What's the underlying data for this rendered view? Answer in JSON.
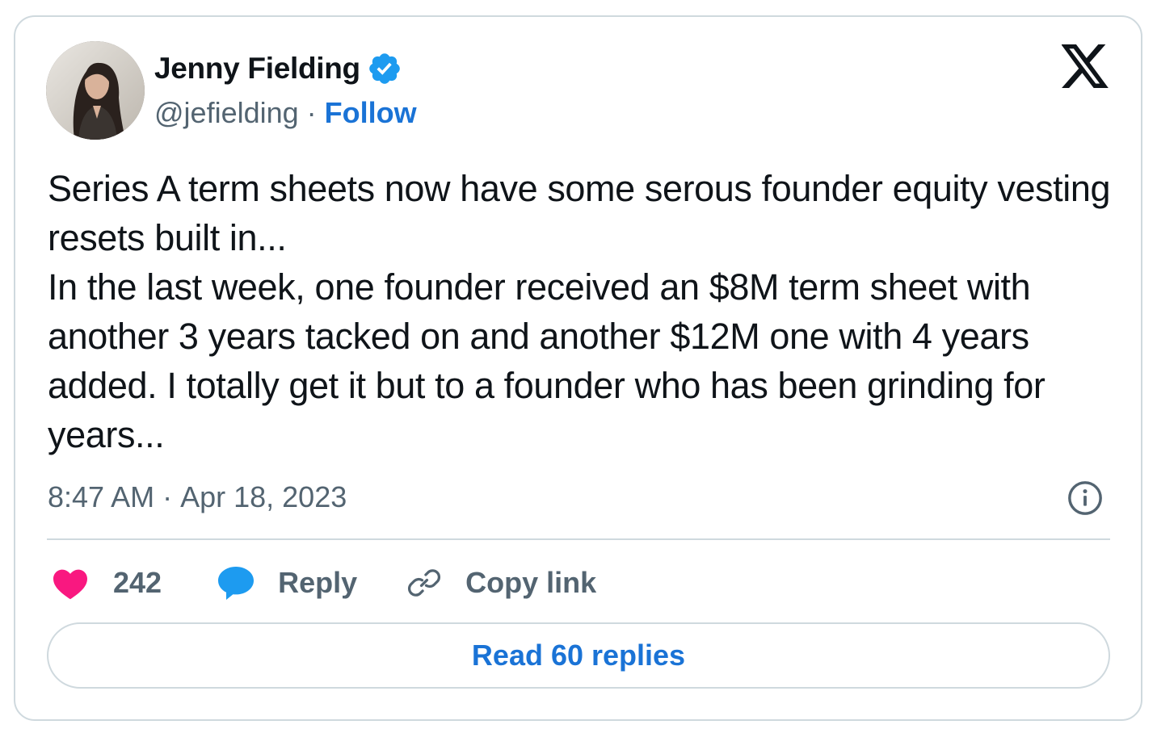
{
  "author": {
    "name": "Jenny Fielding",
    "handle": "@jefielding",
    "separator": "·",
    "follow_label": "Follow",
    "verified_color": "#1d9bf0"
  },
  "tweet": {
    "text": "Series A term sheets now have some serous founder equity vesting resets built in...\nIn the last week, one founder received an $8M term sheet with another 3 years tacked on and another $12M one with 4 years added. I totally get it but to a founder who has been grinding for years...",
    "time": "8:47 AM",
    "separator": "·",
    "date": "Apr 18, 2023"
  },
  "actions": {
    "like_count": "242",
    "reply_label": "Reply",
    "copy_link_label": "Copy link"
  },
  "footer": {
    "read_replies_label": "Read 60 replies"
  },
  "icons": {
    "logo": "x-logo-icon",
    "verified": "verified-badge-icon",
    "info": "info-icon",
    "like": "heart-icon",
    "reply": "speech-bubble-icon",
    "copy": "link-icon"
  },
  "colors": {
    "text": "#0f1419",
    "muted": "#536471",
    "link": "#1a73d6",
    "heart": "#f91880",
    "reply": "#1d9bf0",
    "border": "#cfd9de"
  }
}
